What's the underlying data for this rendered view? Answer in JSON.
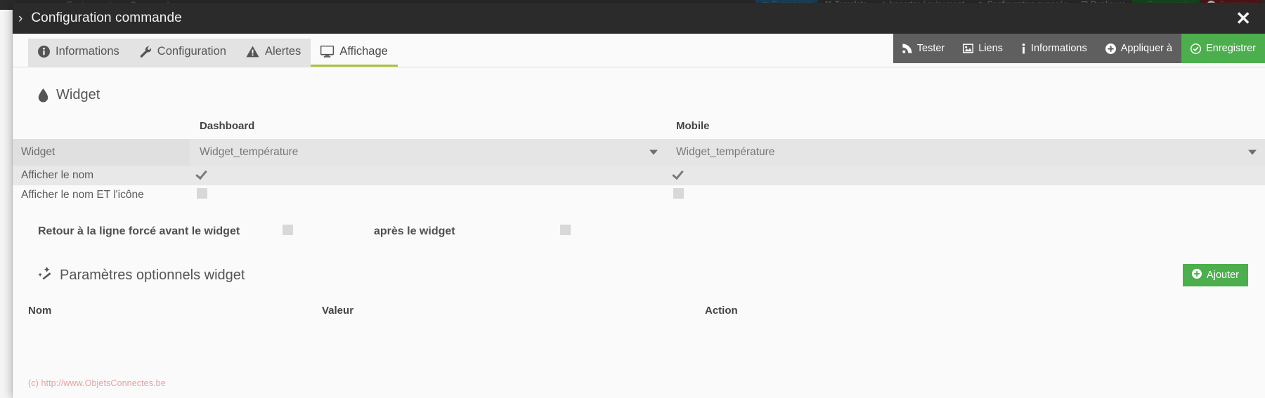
{
  "background": {
    "left_nav": [
      "Equipement",
      "Commandes"
    ],
    "right_buttons": [
      {
        "label": "Expression",
        "icon": "caret-down-icon",
        "style": "expr"
      },
      {
        "label": "Template",
        "icon": "template-icon",
        "style": "plain"
      },
      {
        "label": "Importer équipement",
        "icon": "import-icon",
        "style": "plain"
      },
      {
        "label": "Configuration avancée",
        "icon": "gears-icon",
        "style": "plain"
      },
      {
        "label": "Dupliquer",
        "icon": "copy-icon",
        "style": "plain"
      },
      {
        "label": "Sauvegarder",
        "icon": "check-circle-icon",
        "style": "save"
      },
      {
        "label": "Supprimer",
        "icon": "minus-circle-icon",
        "style": "del"
      }
    ]
  },
  "modal": {
    "title": "Configuration commande",
    "chevron": "›",
    "close": "✕"
  },
  "tabs": [
    {
      "label": "Informations",
      "icon": "info-circle-icon",
      "active": false
    },
    {
      "label": "Configuration",
      "icon": "wrench-icon",
      "active": false
    },
    {
      "label": "Alertes",
      "icon": "warning-triangle-icon",
      "active": false
    },
    {
      "label": "Affichage",
      "icon": "desktop-icon",
      "active": true
    }
  ],
  "actions": [
    {
      "label": "Tester",
      "icon": "rss-icon",
      "style": "grey"
    },
    {
      "label": "Liens",
      "icon": "image-icon",
      "style": "grey"
    },
    {
      "label": "Informations",
      "icon": "info-icon",
      "style": "grey"
    },
    {
      "label": "Appliquer à",
      "icon": "plus-circle-icon",
      "style": "grey"
    },
    {
      "label": "Enregistrer",
      "icon": "check-circle-icon",
      "style": "green"
    }
  ],
  "widget_section": {
    "heading": "Widget",
    "heading_icon": "tint-icon",
    "columns": {
      "dashboard": "Dashboard",
      "mobile": "Mobile"
    },
    "rows": {
      "widget": {
        "label": "Widget",
        "dashboard_value": "Widget_température",
        "mobile_value": "Widget_température"
      },
      "show_name": {
        "label": "Afficher le nom",
        "dashboard_checked": true,
        "mobile_checked": true
      },
      "show_name_icon": {
        "label": "Afficher le nom ET l'icône",
        "dashboard_checked": false,
        "mobile_checked": false
      }
    },
    "linebreak": {
      "label_before": "Retour à la ligne forcé avant le widget",
      "label_after": "après le widget",
      "before_checked": false,
      "after_checked": false
    }
  },
  "optional_section": {
    "heading": "Paramètres optionnels widget",
    "heading_icon": "magic-wand-icon",
    "add_button": "Ajouter",
    "add_button_icon": "plus-circle-icon",
    "table_headers": {
      "name": "Nom",
      "value": "Valeur",
      "action": "Action"
    },
    "rows": []
  },
  "watermark": "(c) http://www.ObjetsConnectes.be",
  "colors": {
    "accent_green": "#4cae4c",
    "tab_underline": "#a9c23f",
    "header_dark": "#2b2b2b",
    "watermark": "#e8a0a0"
  }
}
